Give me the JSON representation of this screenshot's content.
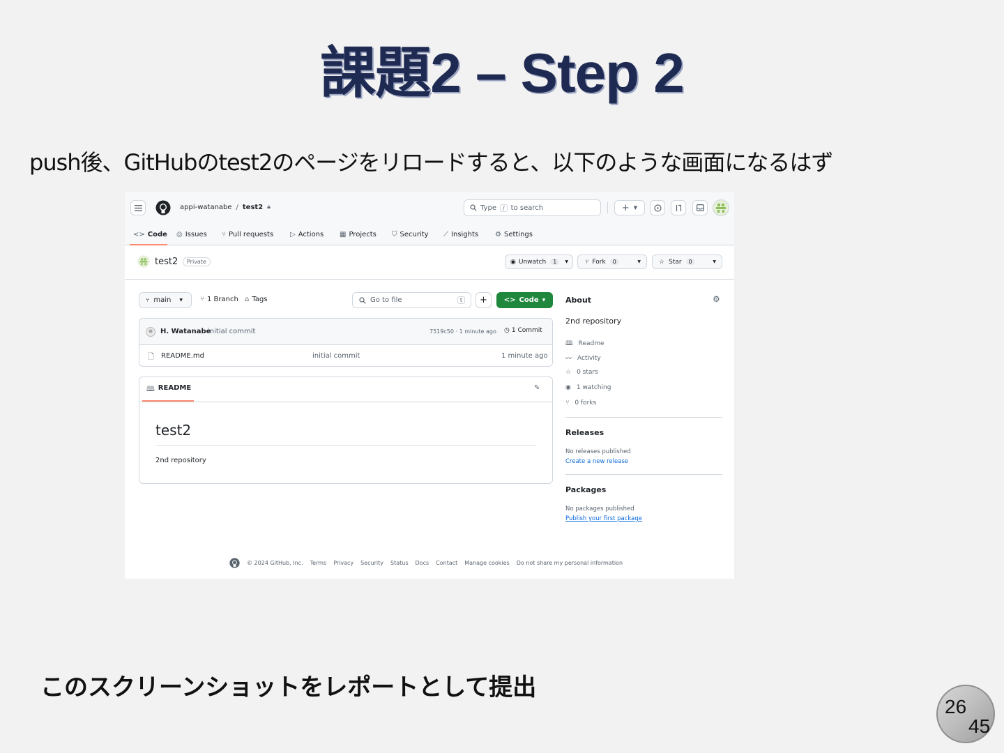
{
  "slide": {
    "title": "課題2 – Step 2",
    "subtitle": "push後、GitHubのtest2のページをリロードすると、以下のような画面になるはず",
    "footer": "このスクリーンショットをレポートとして提出",
    "page_current": "26",
    "page_total": "45"
  },
  "github": {
    "breadcrumb_owner": "appi-watanabe",
    "breadcrumb_sep": "/",
    "breadcrumb_repo": "test2",
    "search_placeholder_pre": "Type",
    "search_key": "/",
    "search_placeholder_post": "to search",
    "plus_label": "+",
    "nav": [
      {
        "label": "Code",
        "icon": "code-icon"
      },
      {
        "label": "Issues",
        "icon": "issue-icon"
      },
      {
        "label": "Pull requests",
        "icon": "pull-request-icon"
      },
      {
        "label": "Actions",
        "icon": "actions-icon"
      },
      {
        "label": "Projects",
        "icon": "projects-icon"
      },
      {
        "label": "Security",
        "icon": "shield-icon"
      },
      {
        "label": "Insights",
        "icon": "graph-icon"
      },
      {
        "label": "Settings",
        "icon": "gear-icon"
      }
    ],
    "repo_name": "test2",
    "visibility": "Private",
    "unwatch_label": "Unwatch",
    "unwatch_count": "1",
    "fork_label": "Fork",
    "fork_count": "0",
    "star_label": "Star",
    "star_count": "0",
    "branch_name": "main",
    "branch_count_label": "1 Branch",
    "tags_label": "Tags",
    "goto_file_placeholder": "Go to file",
    "goto_file_key": "t",
    "add_label": "+",
    "code_button_label": "Code",
    "commit_author": "H. Watanabe",
    "commit_message": "initial commit",
    "commit_hash_time": "7519c50 · 1 minute ago",
    "commit_count_label": "1 Commit",
    "files": [
      {
        "name": "README.md",
        "message": "initial commit",
        "time": "1 minute ago"
      }
    ],
    "readme_tab_label": "README",
    "readme_heading": "test2",
    "readme_body": "2nd repository",
    "about_title": "About",
    "about_description": "2nd repository",
    "about_items": [
      {
        "label": "Readme",
        "icon": "book-icon"
      },
      {
        "label": "Activity",
        "icon": "pulse-icon"
      },
      {
        "label": "0 stars",
        "icon": "star-icon"
      },
      {
        "label": "1 watching",
        "icon": "eye-icon"
      },
      {
        "label": "0 forks",
        "icon": "fork-icon"
      }
    ],
    "releases_title": "Releases",
    "releases_text": "No releases published",
    "releases_link": "Create a new release",
    "packages_title": "Packages",
    "packages_text": "No packages published",
    "packages_link": "Publish your first package",
    "footer_copyright": "© 2024 GitHub, Inc.",
    "footer_links": [
      "Terms",
      "Privacy",
      "Security",
      "Status",
      "Docs",
      "Contact",
      "Manage cookies",
      "Do not share my personal information"
    ],
    "colors": {
      "green": "#1f883d",
      "accent_underline": "#fd8c73",
      "link": "#0969da",
      "border": "#d0d7de"
    }
  }
}
